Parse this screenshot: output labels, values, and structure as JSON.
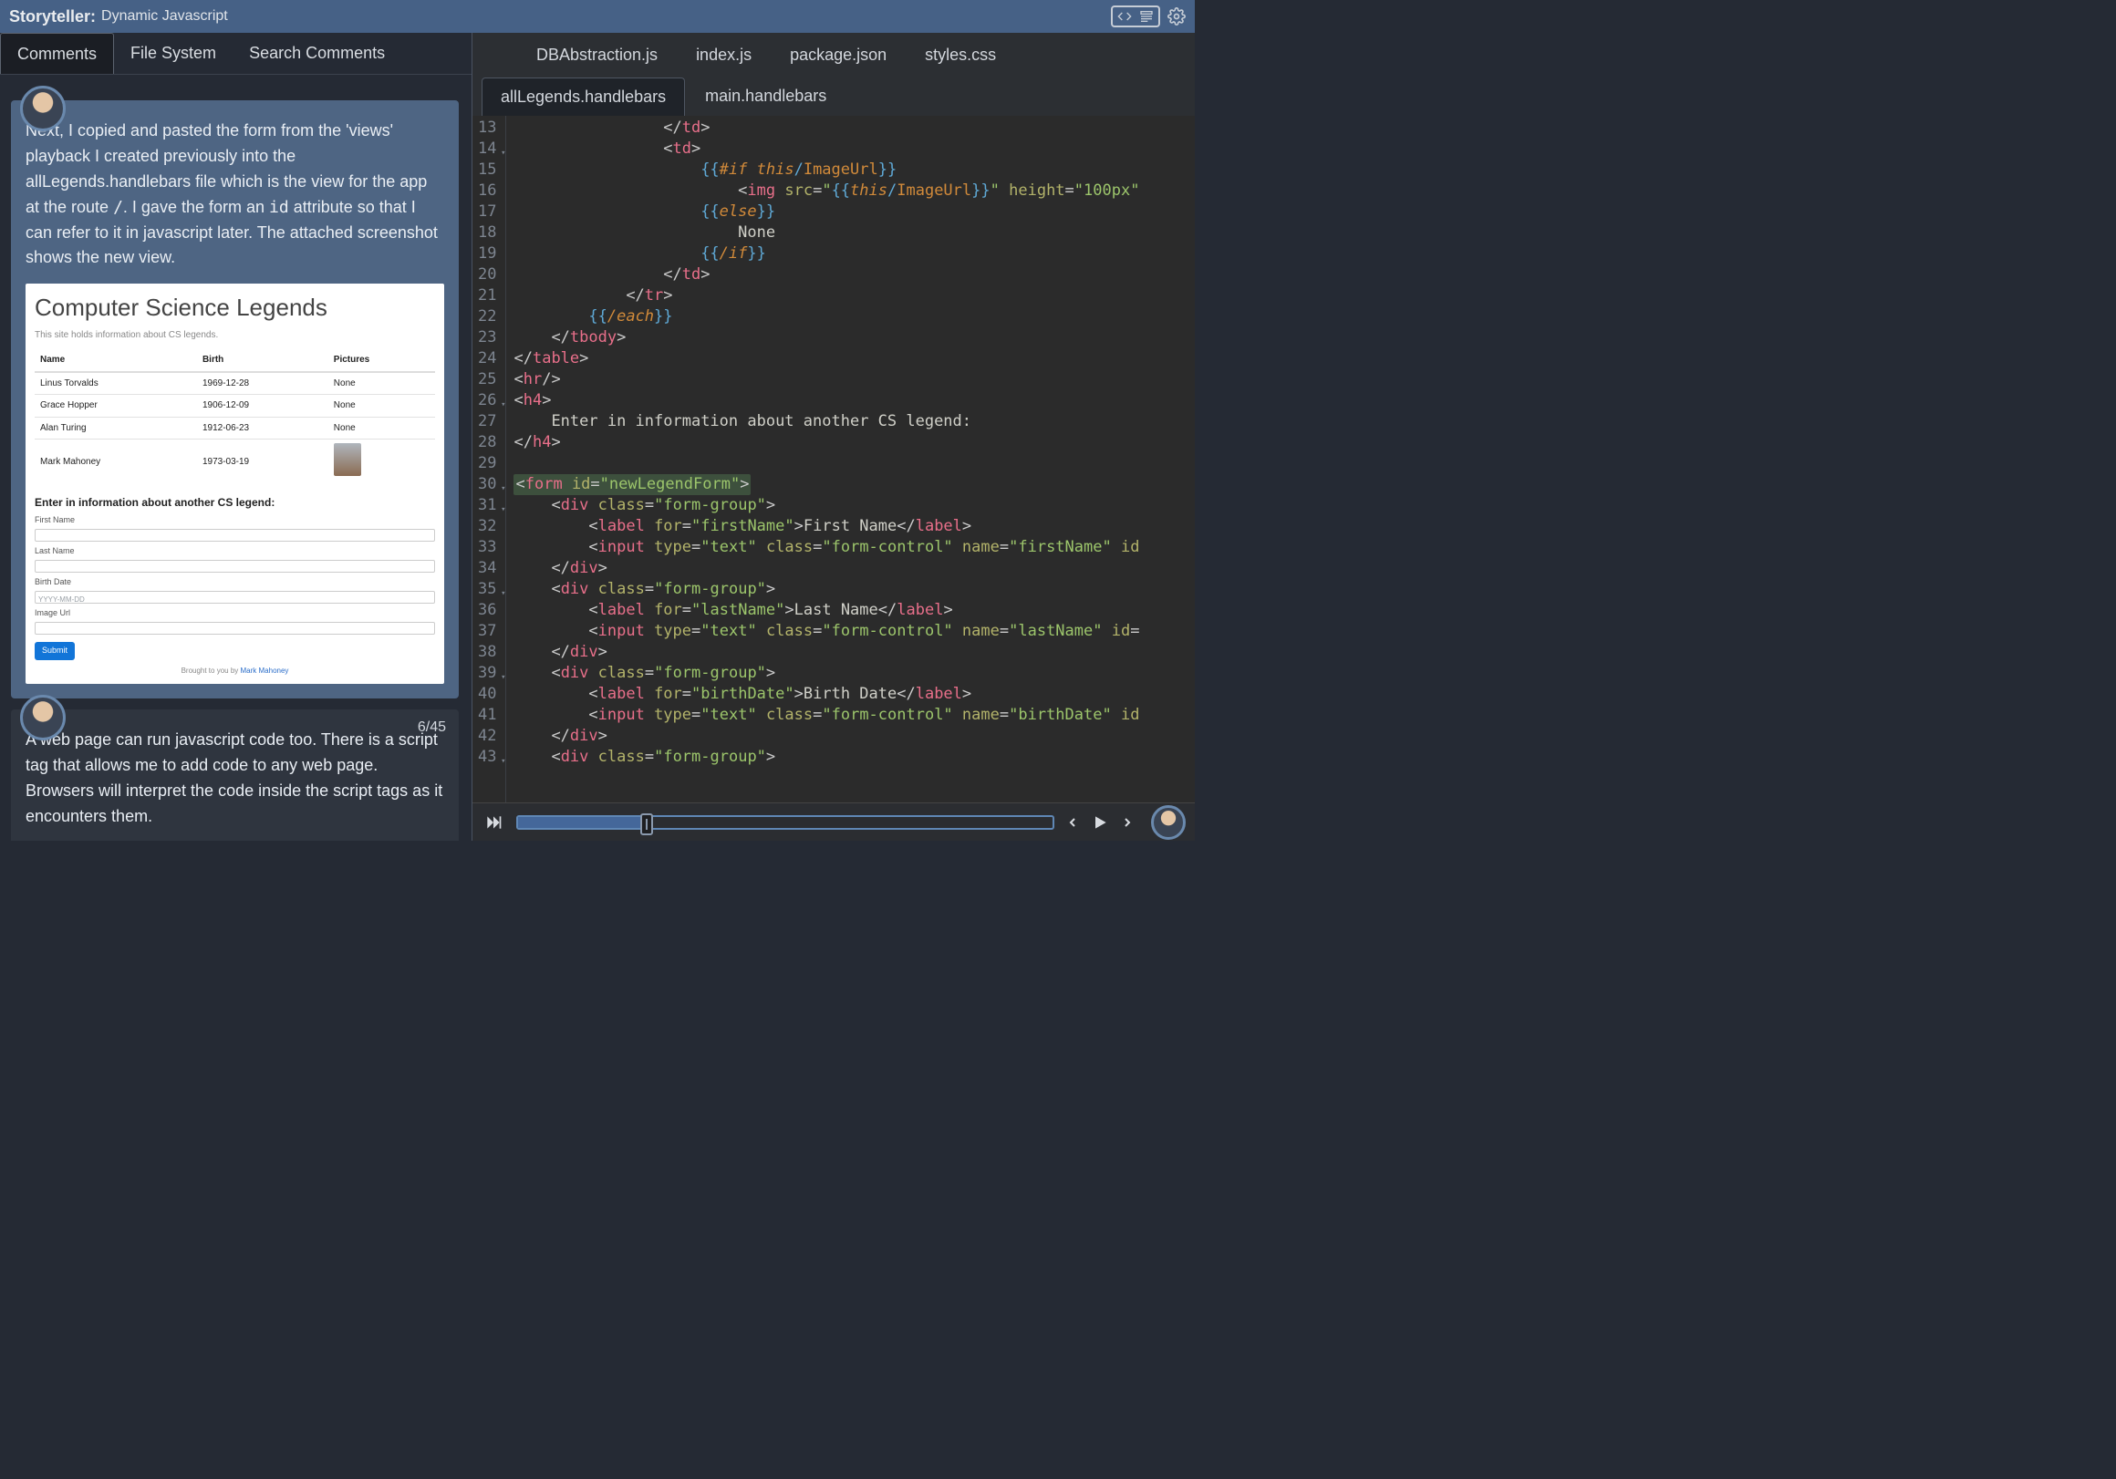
{
  "header": {
    "app_name": "Storyteller:",
    "project": "Dynamic Javascript"
  },
  "left_tabs": [
    {
      "id": "comments",
      "label": "Comments",
      "active": true
    },
    {
      "id": "fs",
      "label": "File System",
      "active": false
    },
    {
      "id": "search",
      "label": "Search Comments",
      "active": false
    }
  ],
  "comments": [
    {
      "id": 1,
      "counter": "",
      "body_html": "Next, I copied and pasted the form from the 'views' playback I created previously into the allLegends.handlebars file which is the view for the app at the route <code>/</code>. I gave the form an <code>id</code> attribute so that I can refer to it in javascript later. The attached screenshot shows the new view.",
      "has_embed": true,
      "dark": false
    },
    {
      "id": 2,
      "counter": "6/45",
      "body_html": "A web page can run javascript code too. There is a script tag that allows me to add code to any web page. Browsers will interpret the code inside the script tags as it encounters them.",
      "has_embed": false,
      "dark": true
    }
  ],
  "embed": {
    "title": "Computer Science Legends",
    "subtitle": "This site holds information about CS legends.",
    "columns": [
      "Name",
      "Birth",
      "Pictures"
    ],
    "rows": [
      {
        "name": "Linus Torvalds",
        "birth": "1969-12-28",
        "pic": "None"
      },
      {
        "name": "Grace Hopper",
        "birth": "1906-12-09",
        "pic": "None"
      },
      {
        "name": "Alan Turing",
        "birth": "1912-06-23",
        "pic": "None"
      },
      {
        "name": "Mark Mahoney",
        "birth": "1973-03-19",
        "pic": "photo"
      }
    ],
    "form_heading": "Enter in information about another CS legend:",
    "labels": {
      "first": "First Name",
      "last": "Last Name",
      "birth": "Birth Date",
      "birth_ph": "YYYY-MM-DD",
      "image": "Image Url",
      "submit": "Submit"
    },
    "footer_prefix": "Brought to you by ",
    "footer_link": "Mark Mahoney"
  },
  "file_tabs_row1": [
    {
      "label": "DBAbstraction.js",
      "active": false
    },
    {
      "label": "index.js",
      "active": false
    },
    {
      "label": "package.json",
      "active": false
    },
    {
      "label": "styles.css",
      "active": false
    }
  ],
  "file_tabs_row2": [
    {
      "label": "allLegends.handlebars",
      "active": true
    },
    {
      "label": "main.handlebars",
      "active": false
    }
  ],
  "editor": {
    "first_line": 13,
    "lines": [
      {
        "n": 13,
        "fold": false,
        "html": "                <span class='tok-punc'>&lt;/</span><span class='tok-tag'>td</span><span class='tok-punc'>&gt;</span>"
      },
      {
        "n": 14,
        "fold": true,
        "html": "                <span class='tok-punc'>&lt;</span><span class='tok-tag'>td</span><span class='tok-punc'>&gt;</span>"
      },
      {
        "n": 15,
        "fold": false,
        "html": "                    <span class='tok-hbs'>{{</span><span class='tok-hbskw'>#if </span><span class='tok-hbskw'>this</span><span class='tok-hbs'>/</span><span class='tok-hbsid'>ImageUrl</span><span class='tok-hbs'>}}</span>"
      },
      {
        "n": 16,
        "fold": false,
        "html": "                        <span class='tok-punc'>&lt;</span><span class='tok-tag'>img</span> <span class='tok-attr'>src</span><span class='tok-punc'>=</span><span class='tok-str'>\"</span><span class='tok-hbs'>{{</span><span class='tok-hbskw'>this</span><span class='tok-hbs'>/</span><span class='tok-hbsid'>ImageUrl</span><span class='tok-hbs'>}}</span><span class='tok-str'>\"</span> <span class='tok-attr'>height</span><span class='tok-punc'>=</span><span class='tok-str'>\"100px\"</span>"
      },
      {
        "n": 17,
        "fold": false,
        "html": "                    <span class='tok-hbs'>{{</span><span class='tok-hbskw'>else</span><span class='tok-hbs'>}}</span>"
      },
      {
        "n": 18,
        "fold": false,
        "html": "                        <span class='tok-txt'>None</span>"
      },
      {
        "n": 19,
        "fold": false,
        "html": "                    <span class='tok-hbs'>{{</span><span class='tok-hbskw'>/if</span><span class='tok-hbs'>}}</span>"
      },
      {
        "n": 20,
        "fold": false,
        "html": "                <span class='tok-punc'>&lt;/</span><span class='tok-tag'>td</span><span class='tok-punc'>&gt;</span>"
      },
      {
        "n": 21,
        "fold": false,
        "html": "            <span class='tok-punc'>&lt;/</span><span class='tok-tag'>tr</span><span class='tok-punc'>&gt;</span>"
      },
      {
        "n": 22,
        "fold": false,
        "html": "        <span class='tok-hbs'>{{</span><span class='tok-hbskw'>/each</span><span class='tok-hbs'>}}</span>"
      },
      {
        "n": 23,
        "fold": false,
        "html": "    <span class='tok-punc'>&lt;/</span><span class='tok-tag'>tbody</span><span class='tok-punc'>&gt;</span>"
      },
      {
        "n": 24,
        "fold": false,
        "html": "<span class='tok-punc'>&lt;/</span><span class='tok-tag'>table</span><span class='tok-punc'>&gt;</span>"
      },
      {
        "n": 25,
        "fold": false,
        "html": "<span class='tok-punc'>&lt;</span><span class='tok-tag'>hr</span><span class='tok-punc'>/&gt;</span>"
      },
      {
        "n": 26,
        "fold": true,
        "html": "<span class='tok-punc'>&lt;</span><span class='tok-tag'>h4</span><span class='tok-punc'>&gt;</span>"
      },
      {
        "n": 27,
        "fold": false,
        "html": "    <span class='tok-txt'>Enter in information about another CS legend:</span>"
      },
      {
        "n": 28,
        "fold": false,
        "html": "<span class='tok-punc'>&lt;/</span><span class='tok-tag'>h4</span><span class='tok-punc'>&gt;</span>"
      },
      {
        "n": 29,
        "fold": false,
        "html": ""
      },
      {
        "n": 30,
        "fold": true,
        "html": "<span class='hl'><span class='tok-punc'>&lt;</span><span class='tok-tag'>form</span> <span class='tok-attr'>id</span><span class='tok-punc'>=</span><span class='tok-str'>\"newLegendForm\"</span><span class='tok-punc'>&gt;</span></span>"
      },
      {
        "n": 31,
        "fold": true,
        "html": "    <span class='tok-punc'>&lt;</span><span class='tok-tag'>div</span> <span class='tok-attr'>class</span><span class='tok-punc'>=</span><span class='tok-str'>\"form-group\"</span><span class='tok-punc'>&gt;</span>"
      },
      {
        "n": 32,
        "fold": false,
        "html": "        <span class='tok-punc'>&lt;</span><span class='tok-tag'>label</span> <span class='tok-attr'>for</span><span class='tok-punc'>=</span><span class='tok-str'>\"firstName\"</span><span class='tok-punc'>&gt;</span><span class='tok-txt'>First Name</span><span class='tok-punc'>&lt;/</span><span class='tok-tag'>label</span><span class='tok-punc'>&gt;</span>"
      },
      {
        "n": 33,
        "fold": false,
        "html": "        <span class='tok-punc'>&lt;</span><span class='tok-tag'>input</span> <span class='tok-attr'>type</span><span class='tok-punc'>=</span><span class='tok-str'>\"text\"</span> <span class='tok-attr'>class</span><span class='tok-punc'>=</span><span class='tok-str'>\"form-control\"</span> <span class='tok-attr'>name</span><span class='tok-punc'>=</span><span class='tok-str'>\"firstName\"</span> <span class='tok-attr'>id</span>"
      },
      {
        "n": 34,
        "fold": false,
        "html": "    <span class='tok-punc'>&lt;/</span><span class='tok-tag'>div</span><span class='tok-punc'>&gt;</span>"
      },
      {
        "n": 35,
        "fold": true,
        "html": "    <span class='tok-punc'>&lt;</span><span class='tok-tag'>div</span> <span class='tok-attr'>class</span><span class='tok-punc'>=</span><span class='tok-str'>\"form-group\"</span><span class='tok-punc'>&gt;</span>"
      },
      {
        "n": 36,
        "fold": false,
        "html": "        <span class='tok-punc'>&lt;</span><span class='tok-tag'>label</span> <span class='tok-attr'>for</span><span class='tok-punc'>=</span><span class='tok-str'>\"lastName\"</span><span class='tok-punc'>&gt;</span><span class='tok-txt'>Last Name</span><span class='tok-punc'>&lt;/</span><span class='tok-tag'>label</span><span class='tok-punc'>&gt;</span>"
      },
      {
        "n": 37,
        "fold": false,
        "html": "        <span class='tok-punc'>&lt;</span><span class='tok-tag'>input</span> <span class='tok-attr'>type</span><span class='tok-punc'>=</span><span class='tok-str'>\"text\"</span> <span class='tok-attr'>class</span><span class='tok-punc'>=</span><span class='tok-str'>\"form-control\"</span> <span class='tok-attr'>name</span><span class='tok-punc'>=</span><span class='tok-str'>\"lastName\"</span> <span class='tok-attr'>id</span><span class='tok-punc'>=</span>"
      },
      {
        "n": 38,
        "fold": false,
        "html": "    <span class='tok-punc'>&lt;/</span><span class='tok-tag'>div</span><span class='tok-punc'>&gt;</span>"
      },
      {
        "n": 39,
        "fold": true,
        "html": "    <span class='tok-punc'>&lt;</span><span class='tok-tag'>div</span> <span class='tok-attr'>class</span><span class='tok-punc'>=</span><span class='tok-str'>\"form-group\"</span><span class='tok-punc'>&gt;</span>"
      },
      {
        "n": 40,
        "fold": false,
        "html": "        <span class='tok-punc'>&lt;</span><span class='tok-tag'>label</span> <span class='tok-attr'>for</span><span class='tok-punc'>=</span><span class='tok-str'>\"birthDate\"</span><span class='tok-punc'>&gt;</span><span class='tok-txt'>Birth Date</span><span class='tok-punc'>&lt;/</span><span class='tok-tag'>label</span><span class='tok-punc'>&gt;</span>"
      },
      {
        "n": 41,
        "fold": false,
        "html": "        <span class='tok-punc'>&lt;</span><span class='tok-tag'>input</span> <span class='tok-attr'>type</span><span class='tok-punc'>=</span><span class='tok-str'>\"text\"</span> <span class='tok-attr'>class</span><span class='tok-punc'>=</span><span class='tok-str'>\"form-control\"</span> <span class='tok-attr'>name</span><span class='tok-punc'>=</span><span class='tok-str'>\"birthDate\"</span> <span class='tok-attr'>id</span>"
      },
      {
        "n": 42,
        "fold": false,
        "html": "    <span class='tok-punc'>&lt;/</span><span class='tok-tag'>div</span><span class='tok-punc'>&gt;</span>"
      },
      {
        "n": 43,
        "fold": true,
        "html": "    <span class='tok-punc'>&lt;</span><span class='tok-tag'>div</span> <span class='tok-attr'>class</span><span class='tok-punc'>=</span><span class='tok-str'>\"form-group\"</span><span class='tok-punc'>&gt;</span>"
      }
    ]
  },
  "playback": {
    "progress_pct": 24,
    "thumb_pct": 24
  }
}
